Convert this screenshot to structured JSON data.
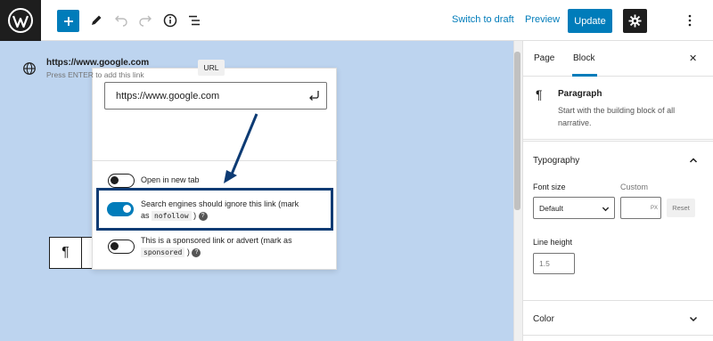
{
  "topbar": {
    "switch_to_draft": "Switch to draft",
    "preview": "Preview",
    "update": "Update"
  },
  "link_popover": {
    "url_value": "https://www.google.com",
    "suggestion_title": "https://www.google.com",
    "suggestion_subtitle": "Press ENTER to add this link",
    "suggestion_badge": "URL",
    "options": [
      {
        "label": "Open in new tab",
        "on": false
      },
      {
        "label_pre": "Search engines should ignore this link (mark",
        "label_as": "as",
        "code": "nofollow",
        "label_post": ")",
        "on": true
      },
      {
        "label_pre": "This is a sponsored link or advert (mark as",
        "code": "sponsored",
        "label_post": ")",
        "on": false
      }
    ]
  },
  "block_toolbar": {
    "icon": "¶"
  },
  "sidebar": {
    "tabs": [
      "Page",
      "Block"
    ],
    "active_tab": "Block",
    "block": {
      "icon": "¶",
      "title": "Paragraph",
      "description": "Start with the building block of all narrative."
    },
    "typography": {
      "title": "Typography",
      "font_size_label": "Font size",
      "custom_label": "Custom",
      "font_size_value": "Default",
      "custom_unit": "PX",
      "reset": "Reset",
      "line_height_label": "Line height",
      "line_height_placeholder": "1.5"
    },
    "color": {
      "title": "Color"
    }
  },
  "colors": {
    "accent": "#007cba",
    "canvas": "#bdd4ef",
    "highlight": "#0d3b74"
  }
}
